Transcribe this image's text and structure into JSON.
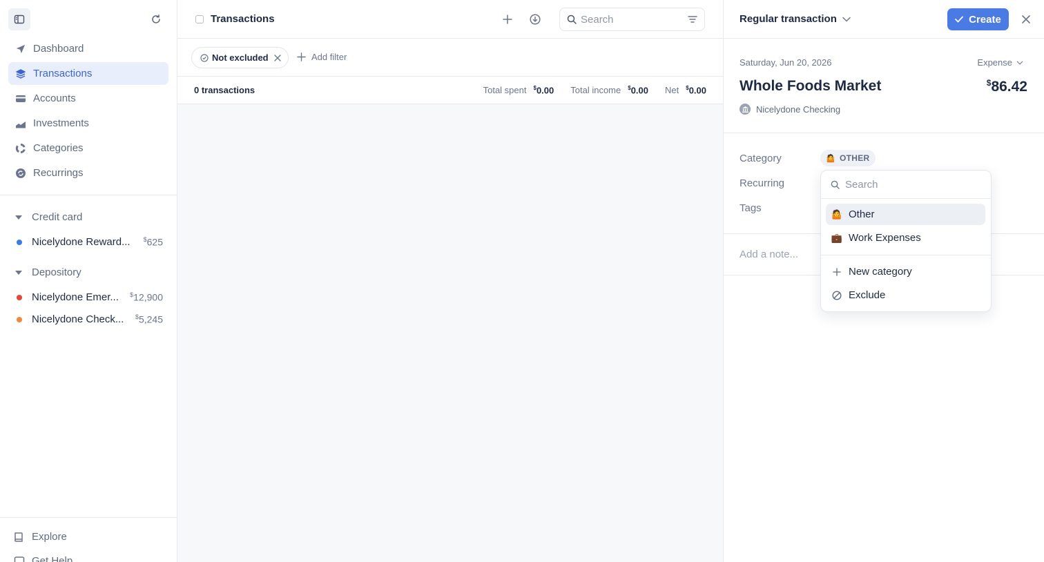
{
  "sidebar": {
    "nav": [
      {
        "label": "Dashboard",
        "icon": "send-icon"
      },
      {
        "label": "Transactions",
        "icon": "layers-icon",
        "active": true
      },
      {
        "label": "Accounts",
        "icon": "card-icon"
      },
      {
        "label": "Investments",
        "icon": "chart-icon"
      },
      {
        "label": "Categories",
        "icon": "ring-icon"
      },
      {
        "label": "Recurrings",
        "icon": "recurring-icon"
      }
    ],
    "groups": [
      {
        "label": "Credit card",
        "accounts": [
          {
            "name": "Nicelydone Reward...",
            "currency": "$",
            "amount": "625",
            "color": "#3b7de8"
          }
        ]
      },
      {
        "label": "Depository",
        "accounts": [
          {
            "name": "Nicelydone Emer...",
            "currency": "$",
            "amount": "12,900",
            "color": "#e5473b"
          },
          {
            "name": "Nicelydone Check...",
            "currency": "$",
            "amount": "5,245",
            "color": "#ef8a3a"
          }
        ]
      }
    ],
    "footer": {
      "explore": "Explore",
      "help": "Get Help"
    }
  },
  "main": {
    "title": "Transactions",
    "search_placeholder": "Search",
    "filter_chip": "Not excluded",
    "add_filter": "Add filter",
    "summary": {
      "count": "0 transactions",
      "spent_label": "Total spent",
      "spent_currency": "$",
      "spent_value": "0.00",
      "income_label": "Total income",
      "income_currency": "$",
      "income_value": "0.00",
      "net_label": "Net",
      "net_currency": "$",
      "net_value": "0.00"
    }
  },
  "panel": {
    "type": "Regular transaction",
    "create": "Create",
    "date": "Saturday, Jun 20, 2026",
    "kind": "Expense",
    "merchant": "Whole Foods Market",
    "amount_currency": "$",
    "amount": "86.42",
    "account": "Nicelydone Checking",
    "category_label": "Category",
    "category_value": "OTHER",
    "recurring_label": "Recurring",
    "tags_label": "Tags",
    "note_placeholder": "Add a note...",
    "accent": "#4a7ae4"
  },
  "dropdown": {
    "search_placeholder": "Search",
    "items": [
      {
        "label": "Other",
        "emoji": "🤷"
      },
      {
        "label": "Work Expenses",
        "emoji": "💼"
      }
    ],
    "actions": [
      {
        "label": "New category"
      },
      {
        "label": "Exclude"
      }
    ]
  }
}
